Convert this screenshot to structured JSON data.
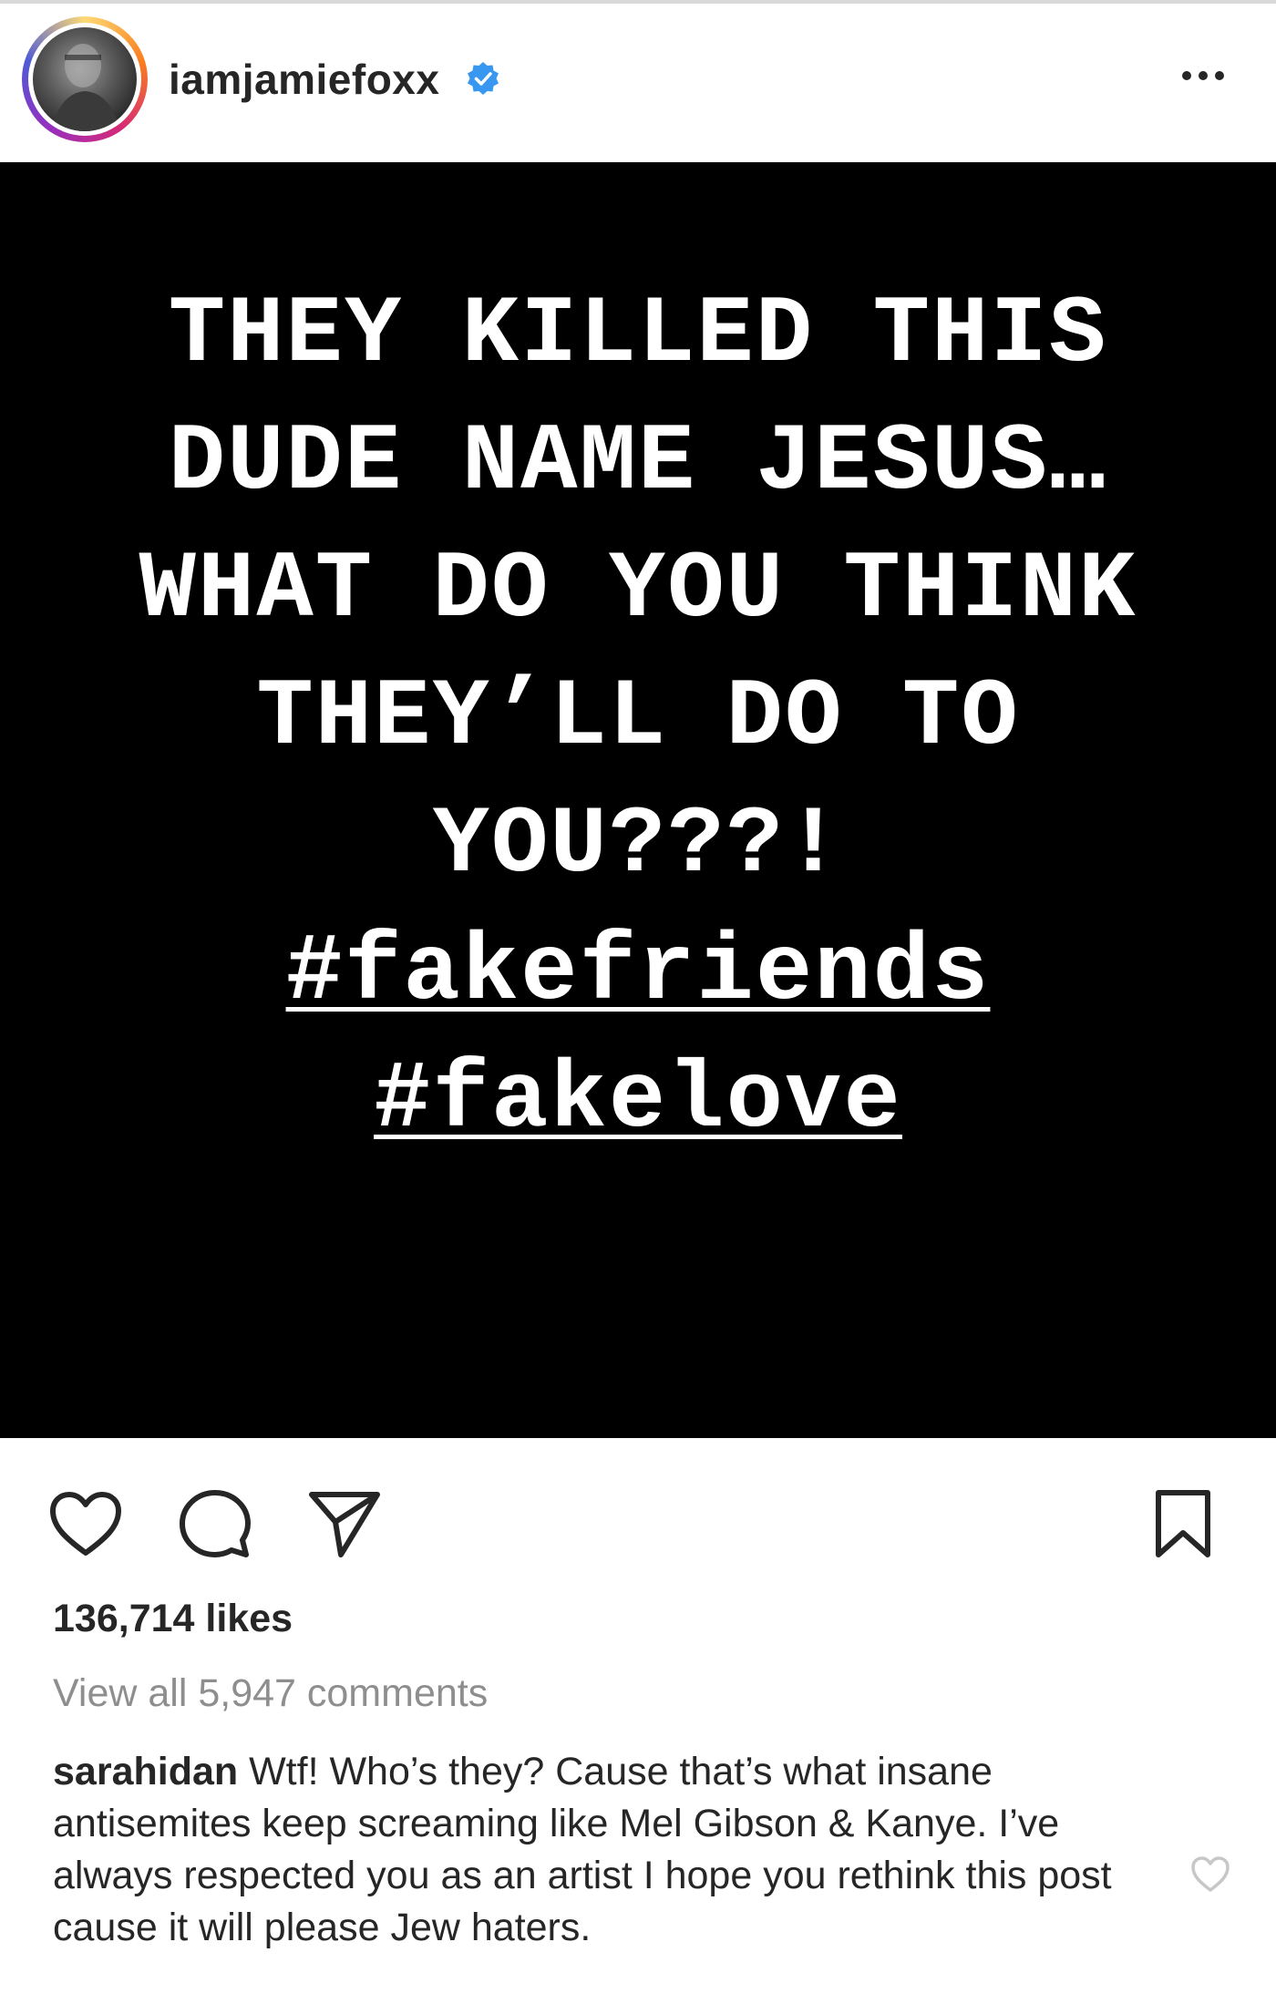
{
  "post": {
    "username": "iamjamiefoxx",
    "verified": true,
    "image_text": {
      "lines": [
        "THEY KILLED THIS",
        "DUDE NAME JESUS…",
        "WHAT DO YOU THINK",
        "THEY’LL DO TO",
        "YOU???!"
      ],
      "hashtags": [
        "#fakefriends",
        "#fakelove"
      ]
    },
    "likes_text": "136,714 likes",
    "view_comments_text": "View all 5,947 comments"
  },
  "comment": {
    "user": "sarahidan",
    "text": "Wtf! Who’s they? Cause that’s what insane antisemites keep screaming like Mel Gibson & Kanye. I’ve always respected you as an artist I hope you rethink this post cause it will please Jew haters."
  },
  "icons": {
    "like": "heart-icon",
    "comment": "comment-bubble-icon",
    "share": "paper-plane-icon",
    "save": "bookmark-icon",
    "more": "more-dots-icon",
    "verified": "verified-badge-icon",
    "comment_like": "small-heart-icon"
  },
  "colors": {
    "verified_blue": "#3897f0",
    "muted_text": "#8e8e8e",
    "post_background": "#000000"
  }
}
